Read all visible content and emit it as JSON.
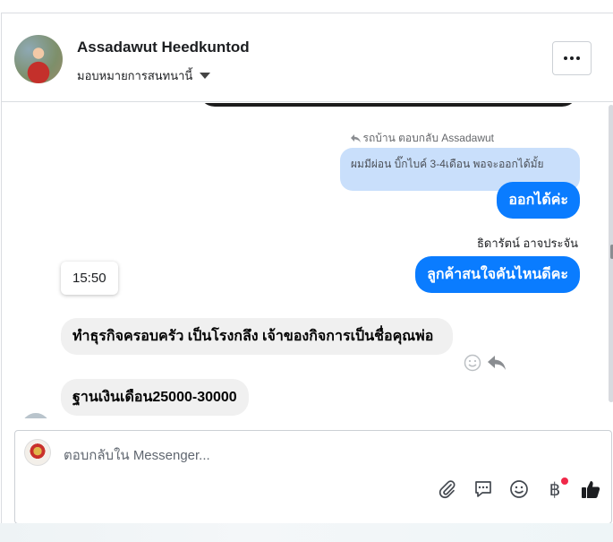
{
  "header": {
    "contact_name": "Assadawut Heedkuntod",
    "assign_label": "มอบหมายการสนทนานี้",
    "more_label": "···"
  },
  "conversation": {
    "reply_meta": "รถบ้าน ตอบกลับ Assadawut",
    "quoted_text": "ผมมีผ่อน บิ๊กไบค์ 3-4เดือน พอจะออกได้มั้ย",
    "reply_text": "ออกได้ค่ะ",
    "sender_name": "ธิดารัตน์ อาจประจัน",
    "outgoing_question": "ลูกค้าสนใจคันไหนดีคะ",
    "timestamp": "15:50",
    "incoming": [
      "ทำธุรกิจครอบครัว เป็นโรงกลึง  เจ้าของกิจการเป็นชื่อคุณพ่อ",
      "ฐานเงินเดือน25000-30000"
    ]
  },
  "composer": {
    "placeholder": "ตอบกลับใน Messenger...",
    "icons": [
      "paperclip-icon",
      "chat-bubble-icon",
      "smiley-icon",
      "baht-icon",
      "thumbs-up-icon"
    ]
  },
  "colors": {
    "outgoing_bubble": "#0a7cff",
    "quoted_bubble": "#c9dffb",
    "incoming_bubble": "#f0f0f0",
    "notification_dot": "#f02849"
  }
}
